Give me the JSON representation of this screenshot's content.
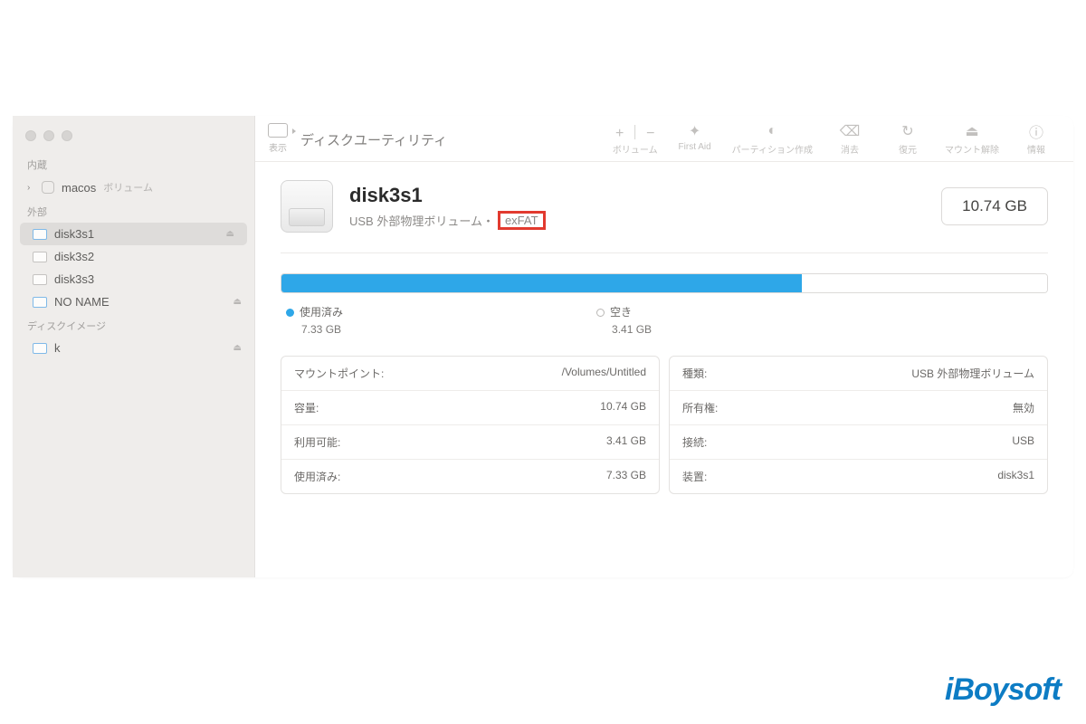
{
  "toolbar": {
    "view_label": "表示",
    "title": "ディスクユーティリティ",
    "buttons": {
      "volume": "ボリューム",
      "firstaid": "First Aid",
      "partition": "パーティション作成",
      "erase": "消去",
      "restore": "復元",
      "unmount": "マウント解除",
      "info": "情報"
    }
  },
  "sidebar": {
    "internal_label": "内蔵",
    "macos": "macos",
    "macos_suffix": "ボリューム",
    "external_label": "外部",
    "items": [
      "disk3s1",
      "disk3s2",
      "disk3s3",
      "NO NAME"
    ],
    "image_label": "ディスクイメージ",
    "image_item": "k"
  },
  "volume": {
    "name": "disk3s1",
    "subtitle_prefix": "USB 外部物理ボリューム・",
    "fs": "exFAT",
    "capacity": "10.74 GB"
  },
  "legend": {
    "used_label": "使用済み",
    "used_value": "7.33 GB",
    "free_label": "空き",
    "free_value": "3.41 GB"
  },
  "info_left": [
    {
      "k": "マウントポイント:",
      "v": "/Volumes/Untitled"
    },
    {
      "k": "容量:",
      "v": "10.74 GB"
    },
    {
      "k": "利用可能:",
      "v": "3.41 GB"
    },
    {
      "k": "使用済み:",
      "v": "7.33 GB"
    }
  ],
  "info_right": [
    {
      "k": "種類:",
      "v": "USB 外部物理ボリューム"
    },
    {
      "k": "所有権:",
      "v": "無効"
    },
    {
      "k": "接続:",
      "v": "USB"
    },
    {
      "k": "装置:",
      "v": "disk3s1"
    }
  ],
  "watermark": "iBoysoft"
}
